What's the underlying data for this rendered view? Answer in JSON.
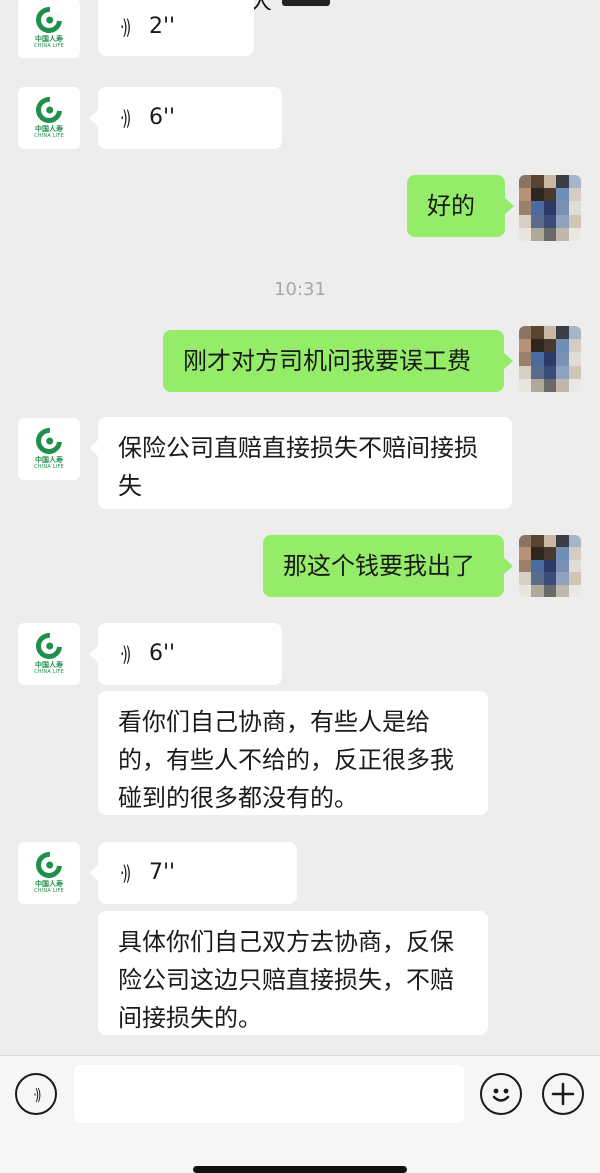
{
  "header": {
    "back_icon": "‹",
    "title": "大"
  },
  "org": {
    "name_cn": "中国人寿",
    "name_en": "CHINA LIFE"
  },
  "messages": {
    "m0": {
      "sender": "org",
      "type": "voice",
      "duration": "2''"
    },
    "m1": {
      "sender": "org",
      "type": "voice",
      "duration": "6''"
    },
    "m2": {
      "sender": "me",
      "type": "text",
      "text": "好的"
    },
    "time1": "10:31",
    "m3": {
      "sender": "me",
      "type": "text",
      "text": "刚才对方司机问我要误工费"
    },
    "m4": {
      "sender": "org",
      "type": "text",
      "text": "保险公司直赔直接损失不赔间接损失"
    },
    "m5": {
      "sender": "me",
      "type": "text",
      "text": "那这个钱要我出了"
    },
    "m6": {
      "sender": "org",
      "type": "voice",
      "duration": "6''"
    },
    "m7": {
      "sender": "org",
      "type": "text",
      "text": "看你们自己协商，有些人是给的，有些人不给的，反正很多我碰到的很多都没有的。"
    },
    "m8": {
      "sender": "org",
      "type": "voice",
      "duration": "7''"
    },
    "m9": {
      "sender": "org",
      "type": "text",
      "text": "具体你们自己双方去协商，反保险公司这边只赔直接损失，不赔间接损失的。"
    }
  },
  "input_bar": {
    "voice_icon": "voice-toggle-icon",
    "emoji_icon": "emoji-icon",
    "plus_icon": "plus-icon"
  },
  "colors": {
    "background": "#ededed",
    "my_bubble": "#95ec69",
    "their_bubble": "#ffffff",
    "brand_green": "#1f8f4a"
  }
}
